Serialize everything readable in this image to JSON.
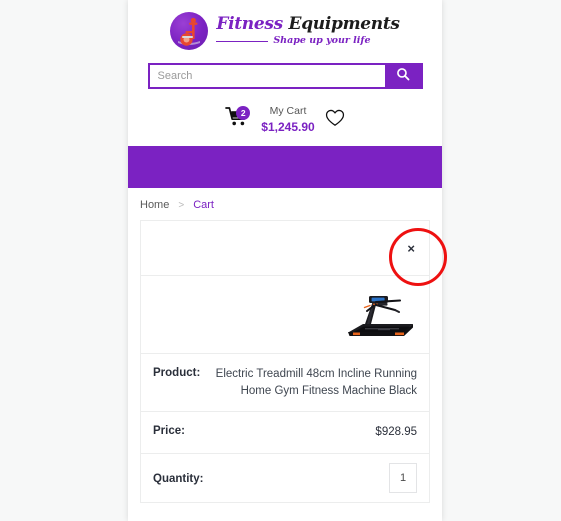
{
  "theme": {
    "brand_purple": "#7b22c2",
    "page_background": "#f7f8f8",
    "annotation_red": "#ee1111",
    "text_dark": "#2a2f3a"
  },
  "header": {
    "logo": {
      "icon": "exercise-bike-icon",
      "title_part1": "Fitness",
      "title_part2": "Equipments",
      "tagline": "Shape up your life"
    },
    "search": {
      "placeholder": "Search",
      "value": "",
      "button_icon": "search-icon"
    },
    "cart": {
      "icon": "shopping-cart-icon",
      "badge_count": "2",
      "label": "My Cart",
      "total": "$1,245.90"
    },
    "wishlist": {
      "icon": "heart-icon"
    }
  },
  "breadcrumb": {
    "home": "Home",
    "separator": ">",
    "current": "Cart"
  },
  "cart_table": {
    "remove_button": "×",
    "product_image_alt": "electric-treadmill-image",
    "rows": [
      {
        "label": "Product:",
        "value": "Electric Treadmill 48cm Incline Running Home Gym Fitness Machine Black"
      },
      {
        "label": "Price:",
        "value": "$928.95"
      },
      {
        "label": "Quantity:",
        "value": "1"
      }
    ]
  }
}
